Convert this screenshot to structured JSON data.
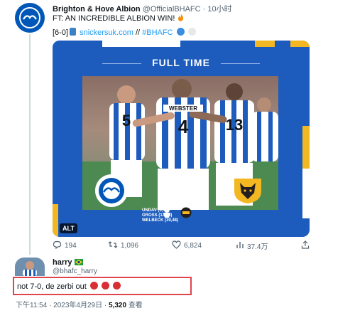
{
  "tweet": {
    "author_name": "Brighton & Hove Albion",
    "author_handle": "@OfficialBHAFC",
    "separator": "·",
    "time": "10小时",
    "text": "FT: AN INCREDIBLE ALBION WIN!",
    "line2_prefix": "[6-0]",
    "line2_link": "snickersuk.com",
    "line2_sep": "//",
    "line2_tag": "#BHAFC",
    "emoji": [
      "fire",
      "mobile-phone",
      "blue-circle",
      "white-circle"
    ]
  },
  "card": {
    "header": "FULL TIME",
    "score": "6-0",
    "scorers": [
      "UNDAV (6,46)",
      "GROSS (13,26)",
      "WELBECK (39,48)"
    ],
    "alt_badge": "ALT",
    "shirt_numbers": [
      "5",
      "4",
      "13"
    ],
    "shirt_name": "WEBSTER",
    "colors": {
      "blue": "#1d5cbd",
      "yellow": "#f2b721",
      "white": "#ffffff"
    }
  },
  "actions": {
    "replies": "194",
    "retweets": "1,096",
    "likes": "6,824",
    "views": "37.4万"
  },
  "reply": {
    "display_name": "harry",
    "handle": "@bhafc_harry",
    "text": "not 7-0, de zerbi out",
    "emoji": [
      "angry-face",
      "angry-face",
      "angry-face"
    ],
    "meta": "下午11:54 · 2023年4月29日 ·",
    "views": "5,320",
    "views_label": "查看"
  }
}
